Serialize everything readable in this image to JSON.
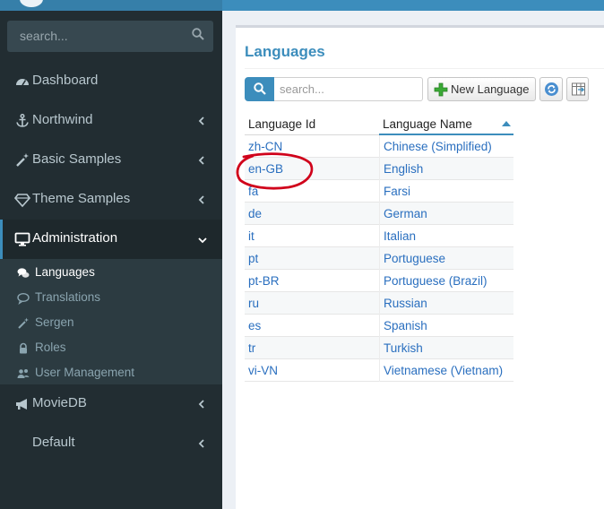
{
  "sidebar": {
    "search": {
      "placeholder": "search..."
    },
    "menu": [
      {
        "label": "Dashboard",
        "icon": "dashboard-icon",
        "expandable": false
      },
      {
        "label": "Northwind",
        "icon": "anchor-icon",
        "expandable": true
      },
      {
        "label": "Basic Samples",
        "icon": "magic-wand-icon",
        "expandable": true
      },
      {
        "label": "Theme Samples",
        "icon": "diamond-icon",
        "expandable": true
      },
      {
        "label": "Administration",
        "icon": "monitor-icon",
        "expandable": true,
        "expanded": true,
        "active": true
      },
      {
        "label": "MovieDB",
        "icon": "megaphone-icon",
        "expandable": true
      },
      {
        "label": "Default",
        "icon": "",
        "expandable": true
      }
    ],
    "admin_submenu": [
      {
        "label": "Languages",
        "icon": "comments-icon",
        "current": true
      },
      {
        "label": "Translations",
        "icon": "comment-icon"
      },
      {
        "label": "Sergen",
        "icon": "magic-wand-icon"
      },
      {
        "label": "Roles",
        "icon": "lock-icon"
      },
      {
        "label": "User Management",
        "icon": "users-icon"
      }
    ]
  },
  "page": {
    "title": "Languages",
    "quick_search": {
      "placeholder": "search..."
    },
    "toolbar": {
      "new_label": "New Language"
    }
  },
  "grid": {
    "columns": [
      "Language Id",
      "Language Name"
    ],
    "sort": {
      "column": "Language Name",
      "direction": "ascending"
    },
    "rows": [
      [
        "zh-CN",
        "Chinese (Simplified)"
      ],
      [
        "en-GB",
        "English"
      ],
      [
        "fa",
        "Farsi"
      ],
      [
        "de",
        "German"
      ],
      [
        "it",
        "Italian"
      ],
      [
        "pt",
        "Portuguese"
      ],
      [
        "pt-BR",
        "Portuguese (Brazil)"
      ],
      [
        "ru",
        "Russian"
      ],
      [
        "es",
        "Spanish"
      ],
      [
        "tr",
        "Turkish"
      ],
      [
        "vi-VN",
        "Vietnamese (Vietnam)"
      ]
    ]
  },
  "colors": {
    "sidebar_bg": "#222d32",
    "submenu_bg": "#2c3b41",
    "accent": "#3c8dbc",
    "link": "#2a6fbf",
    "annotation": "#d0021b"
  }
}
